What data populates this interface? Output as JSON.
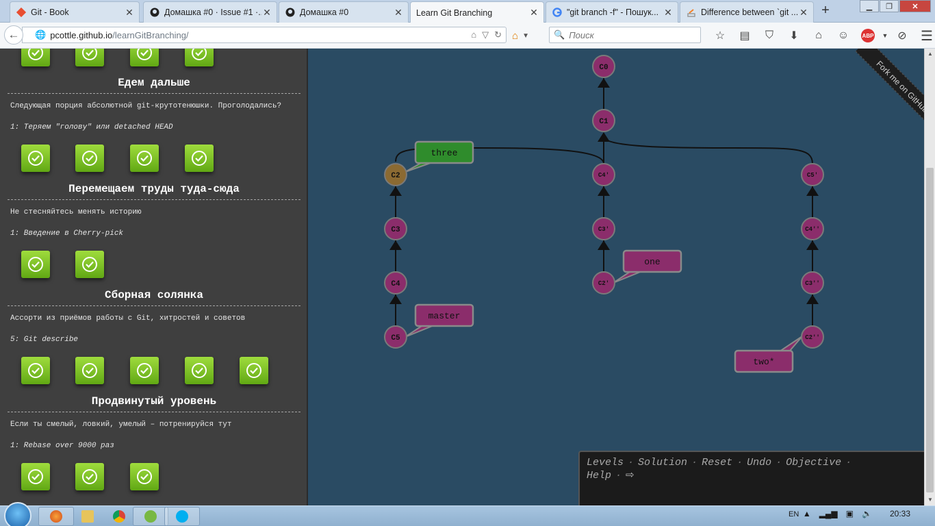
{
  "browser": {
    "tabs": [
      {
        "label": "Git - Book",
        "icon": "git-icon",
        "active": false
      },
      {
        "label": "Домашка #0 · Issue #1 ·...",
        "icon": "github-icon",
        "active": false
      },
      {
        "label": "Домашка #0",
        "icon": "github-icon",
        "active": false
      },
      {
        "label": "Learn Git Branching",
        "icon": "",
        "active": true
      },
      {
        "label": "\"git branch -f\" - Пошук...",
        "icon": "google-icon",
        "active": false
      },
      {
        "label": "Difference between `git ...",
        "icon": "stackoverflow-icon",
        "active": false
      }
    ],
    "new_tab": "+",
    "url_host": "pcottle.github.io",
    "url_path": "/learnGitBranching/",
    "search_placeholder": "Поиск",
    "abp": "ABP"
  },
  "sidebar": {
    "groups": [
      {
        "title": "",
        "desc": "",
        "level": "",
        "done": 4
      },
      {
        "title": "Едем дальше",
        "desc": "Следующая порция абсолютной git-крутотенюшки. Проголодались?",
        "level": "1: Теряем \"голову\" или detached HEAD",
        "done": 4
      },
      {
        "title": "Перемещаем труды туда-сюда",
        "desc": "Не стесняйтесь менять историю",
        "level": "1: Введение в Cherry-pick",
        "done": 2
      },
      {
        "title": "Сборная солянка",
        "desc": "Ассорти из приёмов работы с Git, хитростей и советов",
        "level": "5: Git describe",
        "done": 5
      },
      {
        "title": "Продвинутый уровень",
        "desc": "Если ты смелый, ловкий, умелый – потренируйся тут",
        "level": "1: Rebase over 9000 раз",
        "done": 3
      }
    ]
  },
  "graph": {
    "commits": [
      {
        "id": "C0",
        "color": "#8b2d6b"
      },
      {
        "id": "C1",
        "color": "#8b2d6b"
      },
      {
        "id": "C2",
        "color": "#8b6a32"
      },
      {
        "id": "C3",
        "color": "#8b2d6b"
      },
      {
        "id": "C4",
        "color": "#8b2d6b"
      },
      {
        "id": "C5",
        "color": "#8b2d6b"
      },
      {
        "id": "C4'",
        "color": "#8b2d6b"
      },
      {
        "id": "C3'",
        "color": "#8b2d6b"
      },
      {
        "id": "C2'",
        "color": "#8b2d6b"
      },
      {
        "id": "C5'",
        "color": "#8b2d6b"
      },
      {
        "id": "C4''",
        "color": "#8b2d6b"
      },
      {
        "id": "C3''",
        "color": "#8b2d6b"
      },
      {
        "id": "C2''",
        "color": "#8b2d6b"
      }
    ],
    "branches": [
      {
        "name": "three",
        "color": "#2f8c2c"
      },
      {
        "name": "master",
        "color": "#8b2d6b"
      },
      {
        "name": "one",
        "color": "#8b2d6b"
      },
      {
        "name": "two*",
        "color": "#8b2d6b"
      }
    ]
  },
  "ribbon": "Fork me on GitHub",
  "commandbar": {
    "items": [
      "Levels",
      "Solution",
      "Reset",
      "Undo",
      "Objective",
      "Help"
    ]
  },
  "taskbar": {
    "lang": "EN",
    "time": "20:33"
  }
}
